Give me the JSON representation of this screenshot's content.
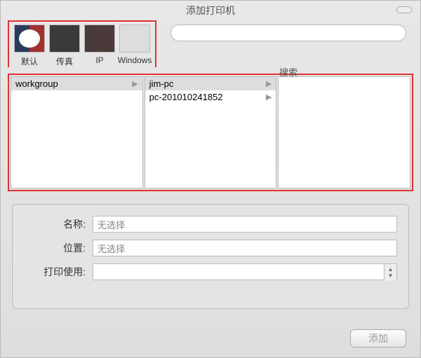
{
  "titlebar": {
    "title": "添加打印机"
  },
  "tabs": {
    "default": "默认",
    "fax": "传真",
    "ip": "IP",
    "windows": "Windows"
  },
  "search": {
    "placeholder": "",
    "label": "搜索"
  },
  "browser": {
    "col1": [
      {
        "label": "workgroup",
        "selected": true
      }
    ],
    "col2": [
      {
        "label": "jim-pc",
        "selected": true
      },
      {
        "label": "pc-201010241852",
        "selected": false
      }
    ],
    "col3": []
  },
  "form": {
    "name_label": "名称:",
    "name_value": "无选择",
    "location_label": "位置:",
    "location_value": "无选择",
    "use_label": "打印使用:"
  },
  "footer": {
    "add": "添加"
  }
}
